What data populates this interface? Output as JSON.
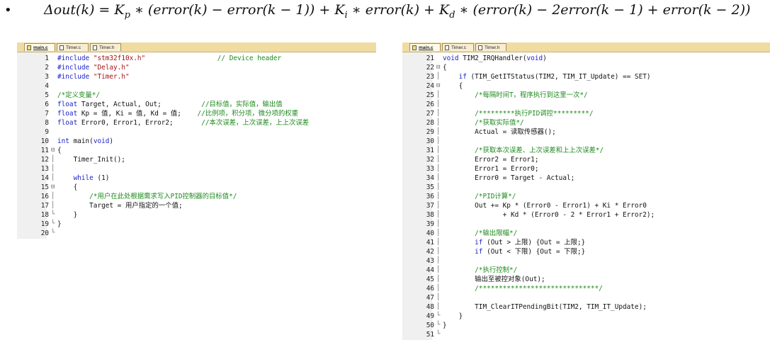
{
  "formula": {
    "bullet": "•",
    "pre": "Δout(k) = K",
    "kp_sub": "p",
    "mid1": " ∗ (error(k) − error(k − 1)) + K",
    "ki_sub": "i",
    "mid2": " ∗ error(k) + K",
    "kd_sub": "d",
    "post": " ∗ (error(k) − 2error(k − 1) + error(k − 2))"
  },
  "editors": [
    {
      "tabs": [
        {
          "label": "main.c",
          "active": true
        },
        {
          "label": "Timer.c",
          "active": false
        },
        {
          "label": "Timer.h",
          "active": false
        }
      ],
      "lines": [
        {
          "n": "1",
          "fold": "",
          "segs": [
            {
              "t": "#include ",
              "c": "pp"
            },
            {
              "t": "\"stm32f10x.h\"",
              "c": "str"
            },
            {
              "t": "                  // Device header",
              "c": "cm"
            }
          ]
        },
        {
          "n": "2",
          "fold": "",
          "segs": [
            {
              "t": "#include ",
              "c": "pp"
            },
            {
              "t": "\"Delay.h\"",
              "c": "str"
            }
          ]
        },
        {
          "n": "3",
          "fold": "",
          "segs": [
            {
              "t": "#include ",
              "c": "pp"
            },
            {
              "t": "\"Timer.h\"",
              "c": "str"
            }
          ]
        },
        {
          "n": "4",
          "fold": "",
          "segs": []
        },
        {
          "n": "5",
          "fold": "",
          "segs": [
            {
              "t": "/*定义变量*/",
              "c": "cm"
            }
          ]
        },
        {
          "n": "6",
          "fold": "",
          "segs": [
            {
              "t": "float",
              "c": "kw"
            },
            {
              "t": " Target, Actual, Out;          ",
              "c": ""
            },
            {
              "t": "//目标值，实际值，输出值",
              "c": "cm"
            }
          ]
        },
        {
          "n": "7",
          "fold": "",
          "segs": [
            {
              "t": "float",
              "c": "kw"
            },
            {
              "t": " Kp = 值, Ki = 值, Kd = 值;    ",
              "c": ""
            },
            {
              "t": "//比例项，积分项，微分项的权重",
              "c": "cm"
            }
          ]
        },
        {
          "n": "8",
          "fold": "",
          "segs": [
            {
              "t": "float",
              "c": "kw"
            },
            {
              "t": " Error0, Error1, Error2;       ",
              "c": ""
            },
            {
              "t": "//本次误差，上次误差，上上次误差",
              "c": "cm"
            }
          ]
        },
        {
          "n": "9",
          "fold": "",
          "segs": []
        },
        {
          "n": "10",
          "fold": "",
          "segs": [
            {
              "t": "int",
              "c": "kw"
            },
            {
              "t": " main(",
              "c": ""
            },
            {
              "t": "void",
              "c": "kw"
            },
            {
              "t": ")",
              "c": ""
            }
          ]
        },
        {
          "n": "11",
          "fold": "⊟",
          "segs": [
            {
              "t": "{",
              "c": ""
            }
          ]
        },
        {
          "n": "12",
          "fold": "│",
          "segs": [
            {
              "t": "    Timer_Init();",
              "c": ""
            }
          ]
        },
        {
          "n": "13",
          "fold": "│",
          "segs": []
        },
        {
          "n": "14",
          "fold": "│",
          "segs": [
            {
              "t": "    ",
              "c": ""
            },
            {
              "t": "while",
              "c": "kw"
            },
            {
              "t": " (1)",
              "c": ""
            }
          ]
        },
        {
          "n": "15",
          "fold": "⊟",
          "segs": [
            {
              "t": "    {",
              "c": ""
            }
          ]
        },
        {
          "n": "16",
          "fold": "│",
          "segs": [
            {
              "t": "        ",
              "c": ""
            },
            {
              "t": "/*用户在此处根据需求写入PID控制器的目标值*/",
              "c": "cm"
            }
          ]
        },
        {
          "n": "17",
          "fold": "│",
          "segs": [
            {
              "t": "        Target = 用户指定的一个值;",
              "c": ""
            }
          ]
        },
        {
          "n": "18",
          "fold": "└",
          "segs": [
            {
              "t": "    }",
              "c": ""
            }
          ]
        },
        {
          "n": "19",
          "fold": "└",
          "segs": [
            {
              "t": "}",
              "c": ""
            }
          ]
        },
        {
          "n": "20",
          "fold": "└",
          "segs": []
        }
      ]
    },
    {
      "tabs": [
        {
          "label": "main.c",
          "active": true
        },
        {
          "label": "Timer.c",
          "active": false
        },
        {
          "label": "Timer.h",
          "active": false
        }
      ],
      "lines": [
        {
          "n": "21",
          "fold": "",
          "segs": [
            {
              "t": "void",
              "c": "kw"
            },
            {
              "t": " TIM2_IRQHandler(",
              "c": ""
            },
            {
              "t": "void",
              "c": "kw"
            },
            {
              "t": ")",
              "c": ""
            }
          ]
        },
        {
          "n": "22",
          "fold": "⊟",
          "segs": [
            {
              "t": "{",
              "c": ""
            }
          ]
        },
        {
          "n": "23",
          "fold": "│",
          "segs": [
            {
              "t": "    ",
              "c": ""
            },
            {
              "t": "if",
              "c": "kw"
            },
            {
              "t": " (TIM_GetITStatus(TIM2, TIM_IT_Update) == SET)",
              "c": ""
            }
          ]
        },
        {
          "n": "24",
          "fold": "⊟",
          "segs": [
            {
              "t": "    {",
              "c": ""
            }
          ]
        },
        {
          "n": "25",
          "fold": "│",
          "segs": [
            {
              "t": "        ",
              "c": ""
            },
            {
              "t": "/*每隔时间T，程序执行到这里一次*/",
              "c": "cm"
            }
          ]
        },
        {
          "n": "26",
          "fold": "│",
          "segs": []
        },
        {
          "n": "27",
          "fold": "│",
          "segs": [
            {
              "t": "        ",
              "c": ""
            },
            {
              "t": "/*********执行PID调控*********/",
              "c": "cm"
            }
          ]
        },
        {
          "n": "28",
          "fold": "│",
          "segs": [
            {
              "t": "        ",
              "c": ""
            },
            {
              "t": "/*获取实际值*/",
              "c": "cm"
            }
          ]
        },
        {
          "n": "29",
          "fold": "│",
          "segs": [
            {
              "t": "        Actual = 读取传感器();",
              "c": ""
            }
          ]
        },
        {
          "n": "30",
          "fold": "│",
          "segs": []
        },
        {
          "n": "31",
          "fold": "│",
          "segs": [
            {
              "t": "        ",
              "c": ""
            },
            {
              "t": "/*获取本次误差、上次误差和上上次误差*/",
              "c": "cm"
            }
          ]
        },
        {
          "n": "32",
          "fold": "│",
          "segs": [
            {
              "t": "        Error2 = Error1;",
              "c": ""
            }
          ]
        },
        {
          "n": "33",
          "fold": "│",
          "segs": [
            {
              "t": "        Error1 = Error0;",
              "c": ""
            }
          ]
        },
        {
          "n": "34",
          "fold": "│",
          "segs": [
            {
              "t": "        Error0 = Target - Actual;",
              "c": ""
            }
          ]
        },
        {
          "n": "35",
          "fold": "│",
          "segs": []
        },
        {
          "n": "36",
          "fold": "│",
          "segs": [
            {
              "t": "        ",
              "c": ""
            },
            {
              "t": "/*PID计算*/",
              "c": "cm"
            }
          ]
        },
        {
          "n": "37",
          "fold": "│",
          "segs": [
            {
              "t": "        Out += Kp * (Error0 - Error1) + Ki * Error0",
              "c": ""
            }
          ]
        },
        {
          "n": "38",
          "fold": "│",
          "segs": [
            {
              "t": "               + Kd * (Error0 - 2 * Error1 + Error2);",
              "c": ""
            }
          ]
        },
        {
          "n": "39",
          "fold": "│",
          "segs": []
        },
        {
          "n": "40",
          "fold": "│",
          "segs": [
            {
              "t": "        ",
              "c": ""
            },
            {
              "t": "/*输出限幅*/",
              "c": "cm"
            }
          ]
        },
        {
          "n": "41",
          "fold": "│",
          "segs": [
            {
              "t": "        ",
              "c": ""
            },
            {
              "t": "if",
              "c": "kw"
            },
            {
              "t": " (Out > 上限) {Out = 上限;}",
              "c": ""
            }
          ]
        },
        {
          "n": "42",
          "fold": "│",
          "segs": [
            {
              "t": "        ",
              "c": ""
            },
            {
              "t": "if",
              "c": "kw"
            },
            {
              "t": " (Out < 下限) {Out = 下限;}",
              "c": ""
            }
          ]
        },
        {
          "n": "43",
          "fold": "│",
          "segs": []
        },
        {
          "n": "44",
          "fold": "│",
          "segs": [
            {
              "t": "        ",
              "c": ""
            },
            {
              "t": "/*执行控制*/",
              "c": "cm"
            }
          ]
        },
        {
          "n": "45",
          "fold": "│",
          "segs": [
            {
              "t": "        输出至被控对象(Out);",
              "c": ""
            }
          ]
        },
        {
          "n": "46",
          "fold": "│",
          "segs": [
            {
              "t": "        ",
              "c": ""
            },
            {
              "t": "/******************************/",
              "c": "cm"
            }
          ]
        },
        {
          "n": "47",
          "fold": "│",
          "segs": []
        },
        {
          "n": "48",
          "fold": "│",
          "segs": [
            {
              "t": "        TIM_ClearITPendingBit(TIM2, TIM_IT_Update);",
              "c": ""
            }
          ]
        },
        {
          "n": "49",
          "fold": "└",
          "segs": [
            {
              "t": "    }",
              "c": ""
            }
          ]
        },
        {
          "n": "50",
          "fold": "└",
          "segs": [
            {
              "t": "}",
              "c": ""
            }
          ]
        },
        {
          "n": "51",
          "fold": "└",
          "segs": []
        }
      ]
    }
  ]
}
